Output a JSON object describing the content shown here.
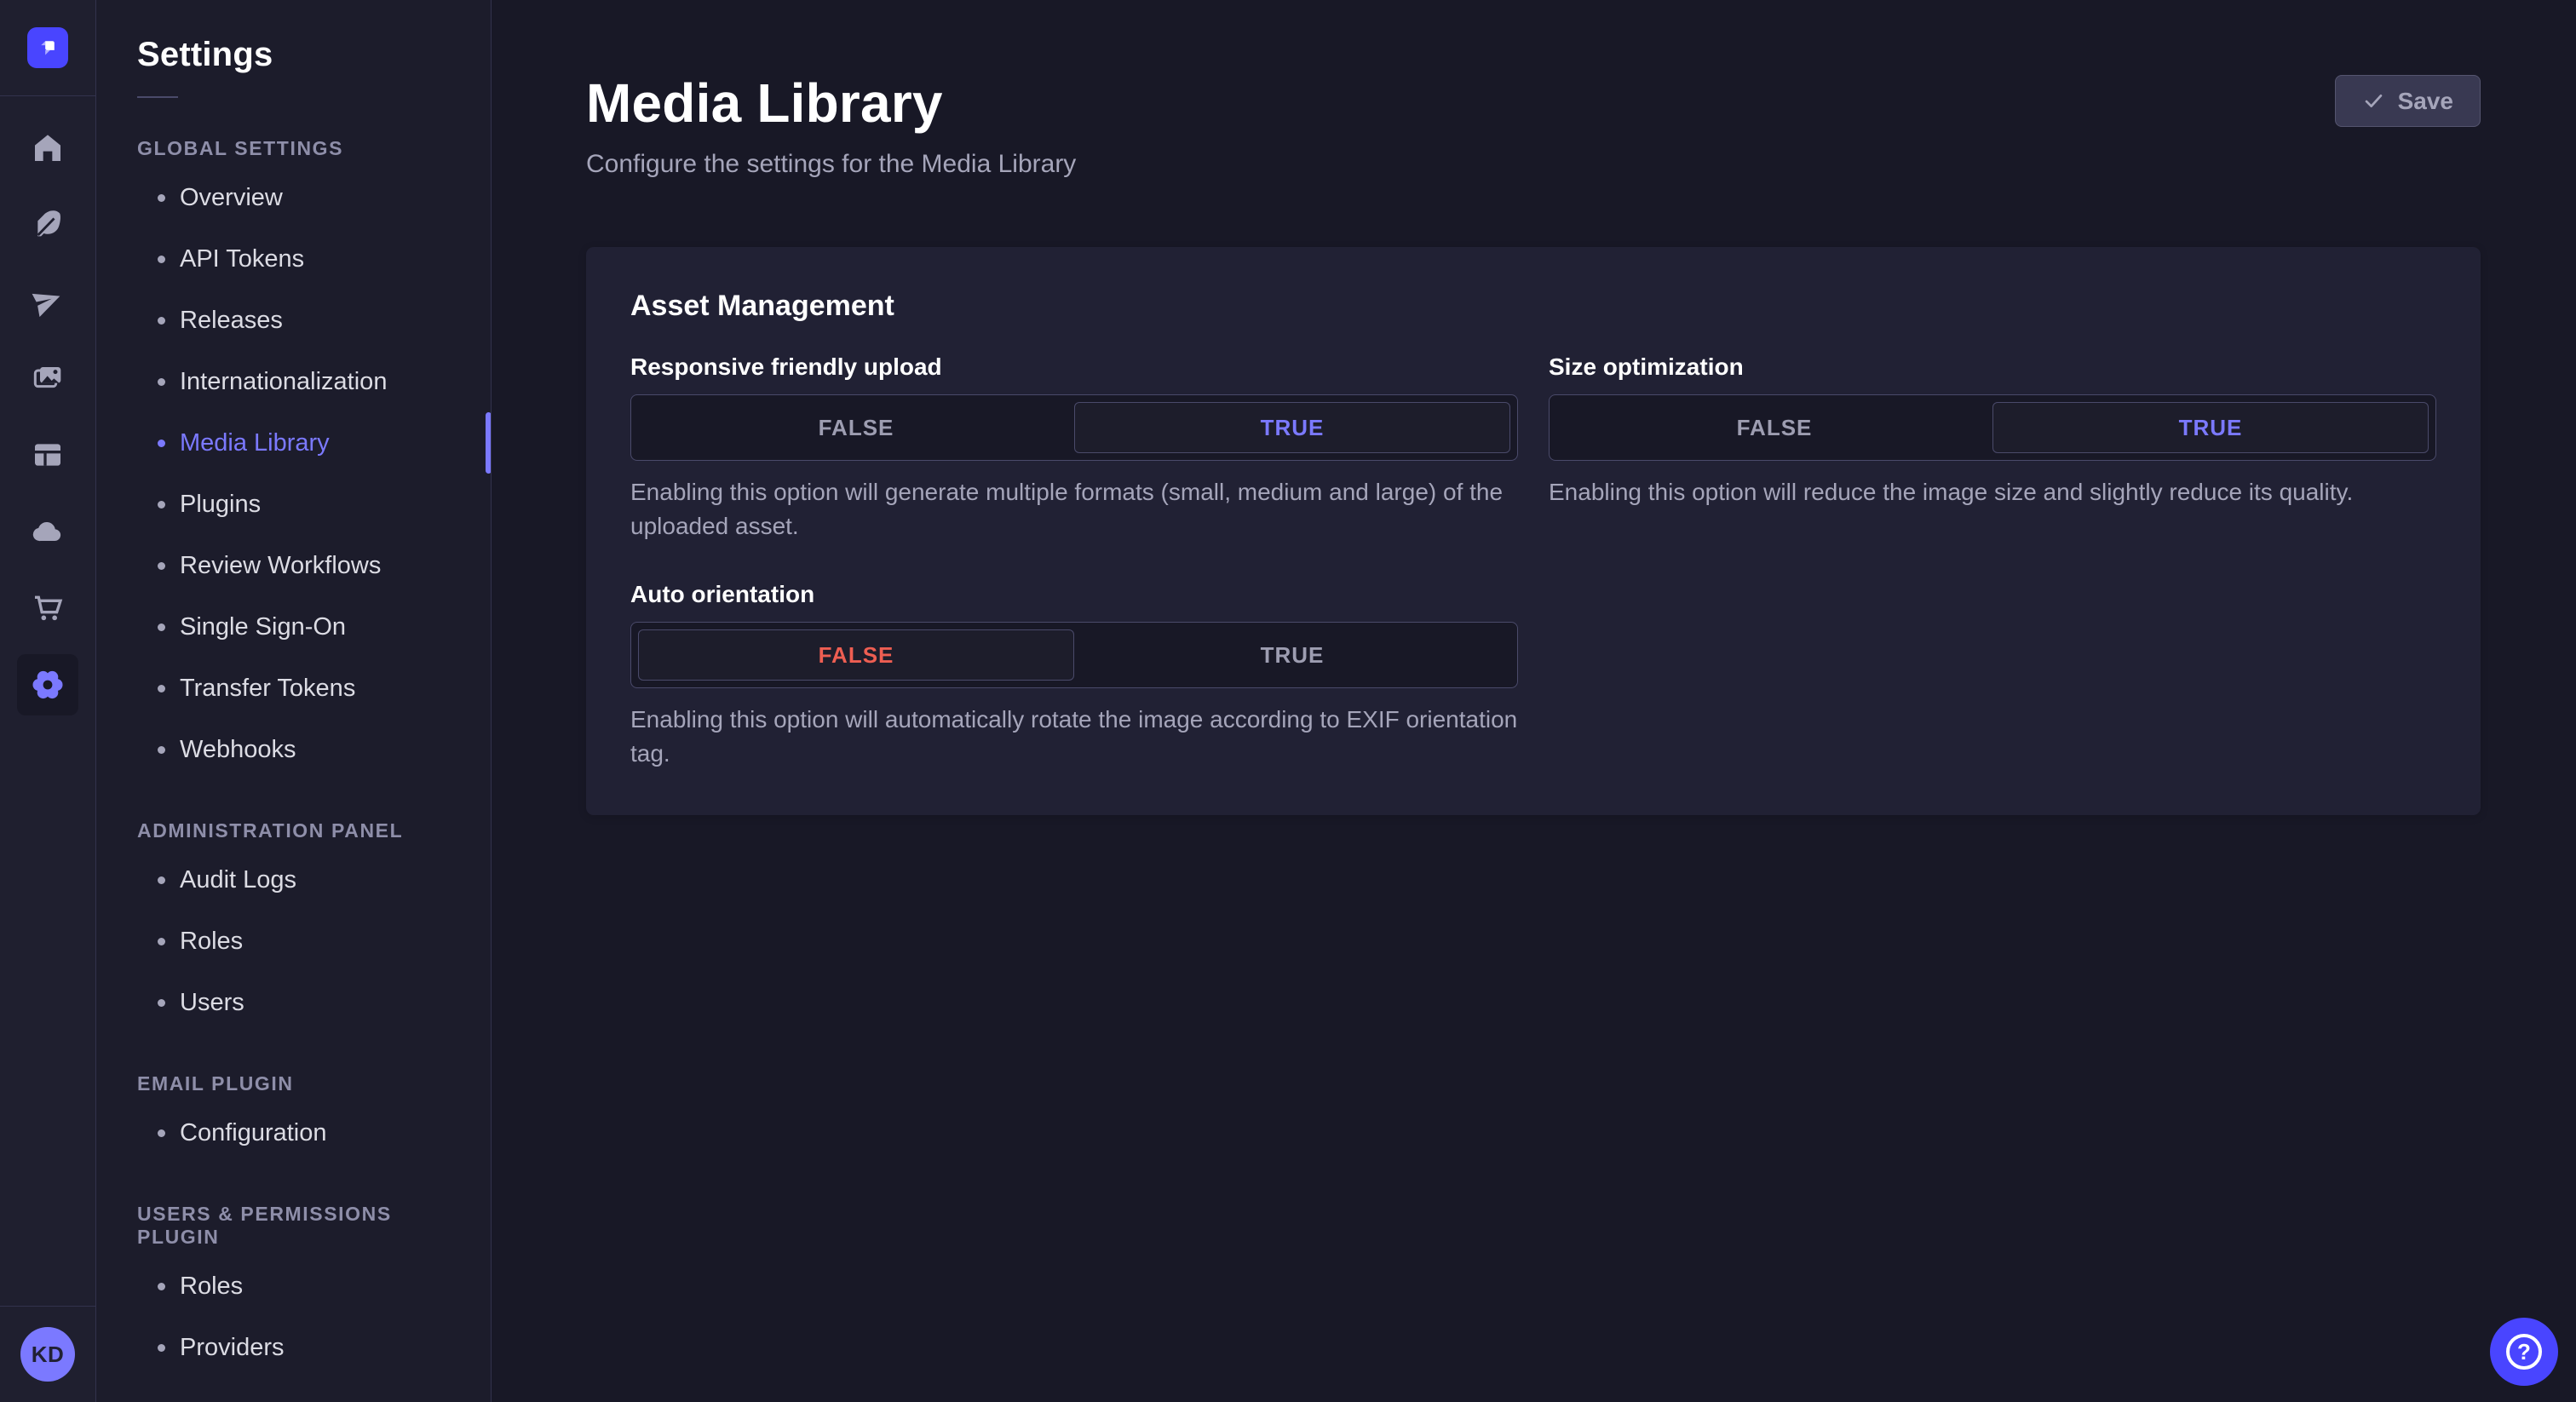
{
  "app": {
    "name": "Strapi admin"
  },
  "colors": {
    "accent": "#4945ff",
    "accent_light": "#7b79ff",
    "danger": "#ee5e52",
    "page_bg": "#181826",
    "card_bg": "#212134"
  },
  "icon_rail": {
    "items": [
      {
        "icon": "home-icon",
        "active": false
      },
      {
        "icon": "feather-icon",
        "active": false
      },
      {
        "icon": "send-icon",
        "active": false
      },
      {
        "icon": "media-icon",
        "active": false
      },
      {
        "icon": "layout-icon",
        "active": false
      },
      {
        "icon": "cloud-icon",
        "active": false
      },
      {
        "icon": "cart-icon",
        "active": false
      },
      {
        "icon": "gear-icon",
        "active": true
      }
    ],
    "user": {
      "initials": "KD"
    }
  },
  "sidebar": {
    "title": "Settings",
    "sections": [
      {
        "label": "GLOBAL SETTINGS",
        "items": [
          {
            "label": "Overview",
            "active": false
          },
          {
            "label": "API Tokens",
            "active": false
          },
          {
            "label": "Releases",
            "active": false
          },
          {
            "label": "Internationalization",
            "active": false
          },
          {
            "label": "Media Library",
            "active": true
          },
          {
            "label": "Plugins",
            "active": false
          },
          {
            "label": "Review Workflows",
            "active": false
          },
          {
            "label": "Single Sign-On",
            "active": false
          },
          {
            "label": "Transfer Tokens",
            "active": false
          },
          {
            "label": "Webhooks",
            "active": false
          }
        ]
      },
      {
        "label": "ADMINISTRATION PANEL",
        "items": [
          {
            "label": "Audit Logs",
            "active": false
          },
          {
            "label": "Roles",
            "active": false
          },
          {
            "label": "Users",
            "active": false
          }
        ]
      },
      {
        "label": "EMAIL PLUGIN",
        "items": [
          {
            "label": "Configuration",
            "active": false
          }
        ]
      },
      {
        "label": "USERS & PERMISSIONS PLUGIN",
        "items": [
          {
            "label": "Roles",
            "active": false
          },
          {
            "label": "Providers",
            "active": false
          }
        ]
      }
    ]
  },
  "header": {
    "title": "Media Library",
    "subtitle": "Configure the settings for the Media Library",
    "save_label": "Save"
  },
  "card": {
    "title": "Asset Management",
    "fields": [
      {
        "label": "Responsive friendly upload",
        "options": [
          "FALSE",
          "TRUE"
        ],
        "value": "TRUE",
        "hint": "Enabling this option will generate multiple formats (small, medium and large) of the uploaded asset."
      },
      {
        "label": "Size optimization",
        "options": [
          "FALSE",
          "TRUE"
        ],
        "value": "TRUE",
        "hint": "Enabling this option will reduce the image size and slightly reduce its quality."
      },
      {
        "label": "Auto orientation",
        "options": [
          "FALSE",
          "TRUE"
        ],
        "value": "FALSE",
        "hint": "Enabling this option will automatically rotate the image according to EXIF orientation tag."
      }
    ]
  },
  "help": {
    "icon": "question-mark-icon"
  }
}
